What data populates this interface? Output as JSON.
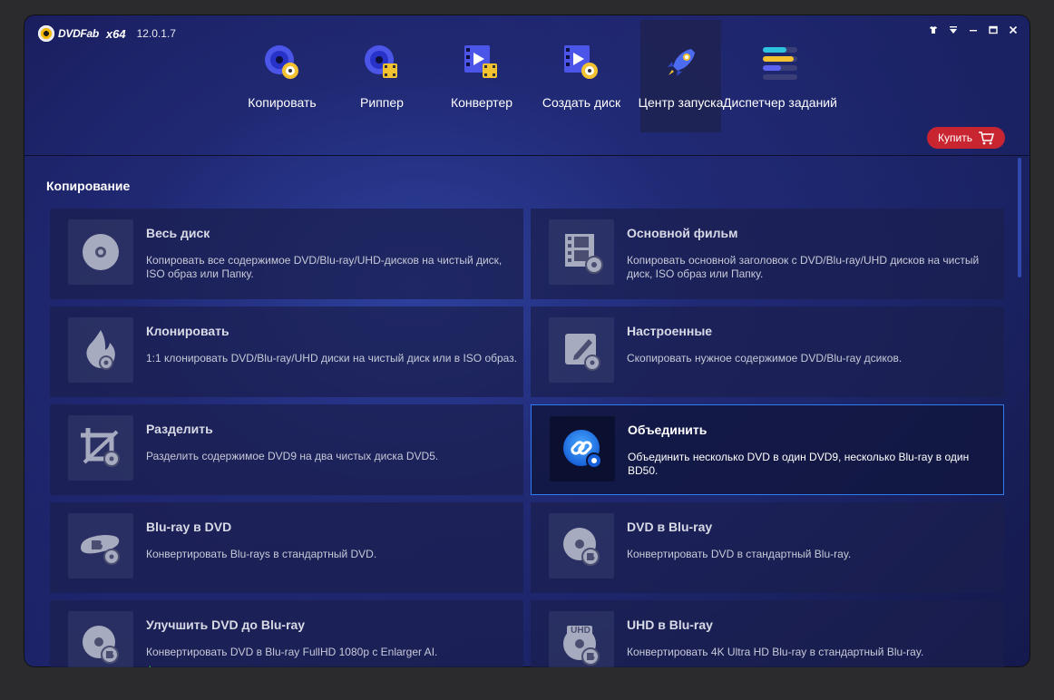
{
  "app": {
    "logo_text": "DVDFab",
    "arch": "x64",
    "version": "12.0.1.7"
  },
  "window_controls": [
    "shirt-icon",
    "dropdown-icon",
    "minimize-icon",
    "maximize-icon",
    "close-icon"
  ],
  "nav": {
    "items": [
      {
        "label": "Копировать",
        "icon": "copy-disc-icon"
      },
      {
        "label": "Риппер",
        "icon": "ripper-icon"
      },
      {
        "label": "Конвертер",
        "icon": "converter-icon"
      },
      {
        "label": "Создать диск",
        "icon": "creator-icon"
      },
      {
        "label": "Центр запуска",
        "icon": "rocket-icon",
        "active": true
      },
      {
        "label": "Диспетчер заданий",
        "icon": "task-manager-icon"
      }
    ],
    "buy_label": "Купить"
  },
  "section": {
    "title": "Копирование"
  },
  "cards": [
    {
      "title": "Весь диск",
      "desc": "Копировать все содержимое DVD/Blu-ray/UHD-дисков на чистый диск, ISO образ или Папку.",
      "icon": "disc-icon"
    },
    {
      "title": "Основной фильм",
      "desc": "Копировать основной заголовок с DVD/Blu-ray/UHD дисков на чистый диск, ISO образ или Папку.",
      "icon": "film-icon"
    },
    {
      "title": "Клонировать",
      "desc": "1:1 клонировать DVD/Blu-ray/UHD диски на чистый диск или в ISO образ.",
      "icon": "flame-icon"
    },
    {
      "title": "Настроенные",
      "desc": "Скопировать нужное содержимое DVD/Blu-ray дсиков.",
      "icon": "edit-icon"
    },
    {
      "title": "Разделить",
      "desc": "Разделить содержимое DVD9 на два чистых диска DVD5.",
      "icon": "crop-icon"
    },
    {
      "title": "Объединить",
      "desc": "Объединить несколько DVD в один DVD9, несколько Blu-ray в один BD50.",
      "icon": "link-icon",
      "active": true
    },
    {
      "title": "Blu-ray в DVD",
      "desc": "Конвертировать Blu-rays в стандартный DVD.",
      "icon": "bluray-icon"
    },
    {
      "title": "DVD в Blu-ray",
      "desc": "Конвертировать DVD в стандартный Blu-ray.",
      "icon": "dvd-to-bluray-icon"
    },
    {
      "title": "Улучшить DVD до Blu-ray",
      "desc": "Конвертировать DVD в Blu-ray FullHD 1080p с Enlarger AI.",
      "icon": "enlarger-icon"
    },
    {
      "title": "UHD в Blu-ray",
      "desc": "Конвертировать 4K Ultra HD Blu-ray в стандартный Blu-ray.",
      "icon": "uhd-icon",
      "badge": "UHD"
    }
  ],
  "colors": {
    "accent": "#2f7cf0",
    "buy": "#c82531",
    "badge_green": "#29a84a"
  }
}
